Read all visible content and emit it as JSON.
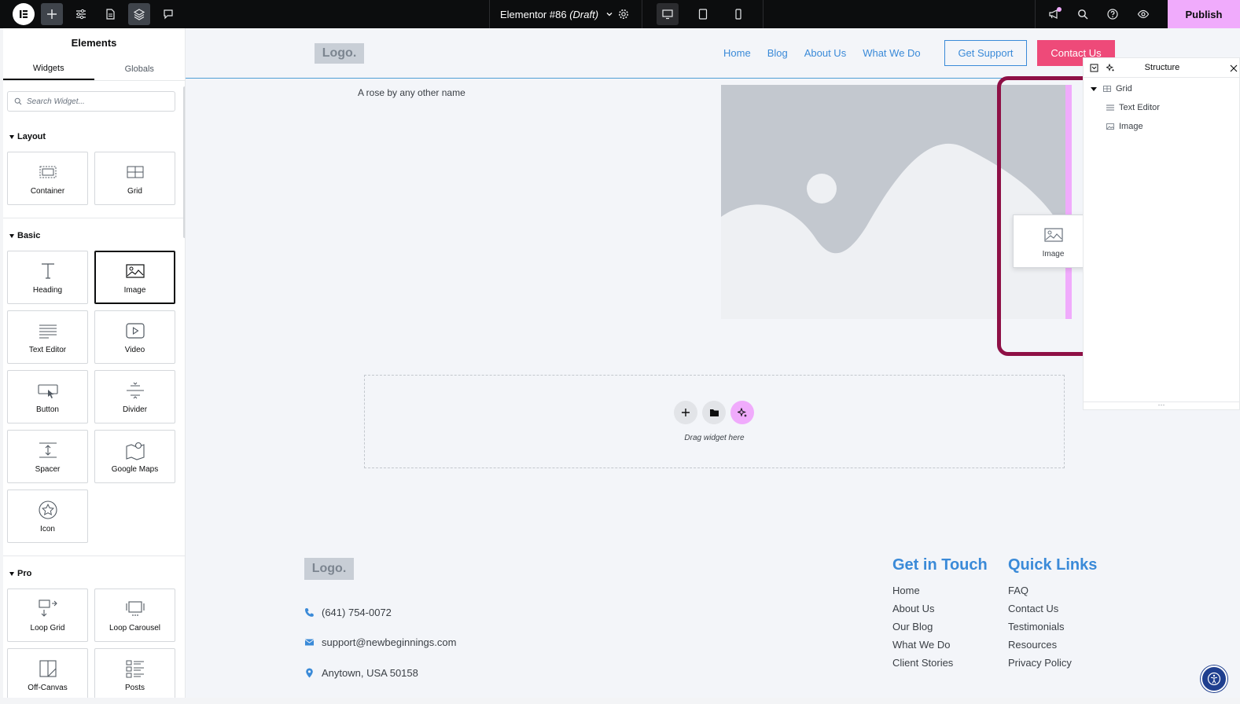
{
  "topbar": {
    "doc_title": "Elementor #86",
    "doc_status": "(Draft)",
    "publish_label": "Publish"
  },
  "panel": {
    "title": "Elements",
    "tabs": [
      "Widgets",
      "Globals"
    ],
    "search_placeholder": "Search Widget...",
    "categories": {
      "layout": "Layout",
      "basic": "Basic",
      "pro": "Pro"
    },
    "layout_widgets": [
      "Container",
      "Grid"
    ],
    "basic_widgets": [
      "Heading",
      "Image",
      "Text Editor",
      "Video",
      "Button",
      "Divider",
      "Spacer",
      "Google Maps",
      "Icon"
    ],
    "pro_widgets": [
      "Loop Grid",
      "Loop Carousel",
      "Off-Canvas",
      "Posts"
    ]
  },
  "site": {
    "logo": "Logo.",
    "nav": [
      "Home",
      "Blog",
      "About Us",
      "What We Do"
    ],
    "btn_support": "Get Support",
    "btn_contact": "Contact Us",
    "rose_text": "A rose by any other name",
    "drag_ghost_label": "Image",
    "drop_text": "Drag widget here"
  },
  "footer": {
    "logo": "Logo.",
    "phone": "(641) 754-0072",
    "email": "support@newbeginnings.com",
    "address": "Anytown, USA 50158",
    "get_in_touch_title": "Get in Touch",
    "get_in_touch": [
      "Home",
      "About Us",
      "Our Blog",
      "What We Do",
      "Client Stories"
    ],
    "quick_links_title": "Quick Links",
    "quick_links": [
      "FAQ",
      "Contact Us",
      "Testimonials",
      "Resources",
      "Privacy Policy"
    ]
  },
  "structure": {
    "title": "Structure",
    "items": [
      "Grid",
      "Text Editor",
      "Image"
    ]
  },
  "colors": {
    "accent": "#3a8ad8",
    "contact": "#ee4a79",
    "publish": "#f0abfc",
    "highlight": "#8e1046"
  }
}
